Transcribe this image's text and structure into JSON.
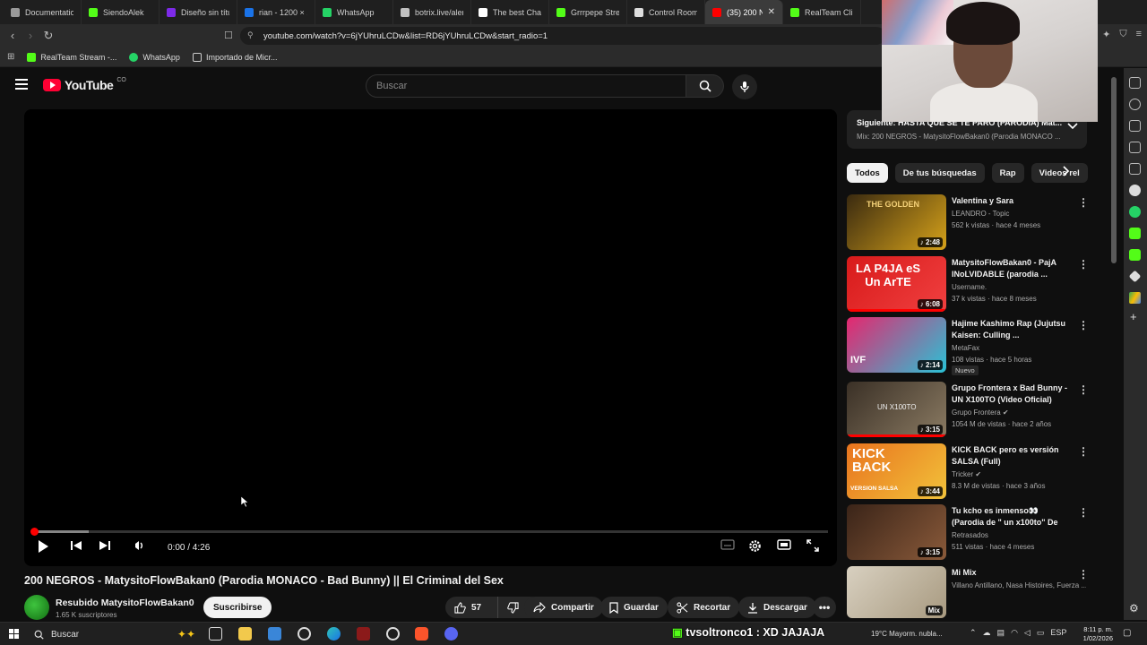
{
  "browser": {
    "tabs": [
      {
        "label": "Documentation",
        "color": "#9a9a9a"
      },
      {
        "label": "SiendoAlek",
        "color": "#53fc18"
      },
      {
        "label": "Diseño sin título",
        "color": "#7d2ae8"
      },
      {
        "label": "rian - 1200 × 12",
        "color": "#1a73e8"
      },
      {
        "label": "WhatsApp",
        "color": "#25d366"
      },
      {
        "label": "botrix.live/alert",
        "color": "#c0c0c0"
      },
      {
        "label": "The best ChatB",
        "color": "#ffffff"
      },
      {
        "label": "Grrrpepe Stream",
        "color": "#53fc18"
      },
      {
        "label": "Control Room",
        "color": "#dddddd"
      },
      {
        "label": "(35) 200 N",
        "color": "#ff0000"
      },
      {
        "label": "RealTeam Clips",
        "color": "#53fc18"
      }
    ],
    "url": "youtube.com/watch?v=6jYUhruLCDw&list=RD6jYUhruLCDw&start_radio=1",
    "bookmarks": [
      {
        "label": "RealTeam Stream -...",
        "color": "#53fc18"
      },
      {
        "label": "WhatsApp",
        "color": "#25d366"
      },
      {
        "label": "Importado de Micr...",
        "color": "#cccccc"
      }
    ]
  },
  "youtube": {
    "logo_text": "YouTube",
    "country_code": "CO",
    "search_placeholder": "Buscar",
    "player": {
      "time": "0:00 / 4:26",
      "progress_fraction": 0.0,
      "buffer_fraction": 0.07
    },
    "video": {
      "title": "200 NEGROS - MatysitoFlowBakan0 (Parodia MONACO - Bad Bunny) || El Criminal del Sex",
      "channel": "Resubido MatysitoFlowBakan0",
      "subscribers": "1.65 K suscriptores",
      "subscribe_label": "Suscribirse",
      "likes": "57",
      "share_label": "Compartir",
      "save_label": "Guardar",
      "clip_label": "Recortar",
      "download_label": "Descargar"
    },
    "next": {
      "title": "Siguiente: HASTA QUE SE TE PARO (PARODIA) Mat...",
      "subtitle": "Mix: 200 NEGROS - MatysitoFlowBakan0 (Parodia MONACO ..."
    },
    "chips": [
      "Todos",
      "De tus búsquedas",
      "Rap",
      "Videos rel"
    ],
    "recommendations": [
      {
        "title": "Valentina y Sara",
        "channel": "LEANDRO - Topic",
        "meta": "562 k vistas · hace 4 meses",
        "duration": "2:48",
        "thumb_colors": [
          "#3a2a10",
          "#d6a21a"
        ],
        "badge": "",
        "verified": false
      },
      {
        "title": "MatysitoFlowBakan0 - PajA INoLVIDABLE (parodia ...",
        "channel": "Username.",
        "meta": "37 k vistas · hace 8 meses",
        "duration": "6:08",
        "thumb_colors": [
          "#d81a1a",
          "#f04040"
        ],
        "badge": "",
        "verified": false
      },
      {
        "title": "Hajime Kashimo Rap (Jujutsu Kaisen: Culling ...",
        "channel": "MetaFax",
        "meta": "108 vistas · hace 5 horas",
        "duration": "2:14",
        "thumb_colors": [
          "#e6266e",
          "#29c2d6"
        ],
        "badge": "Nuevo",
        "verified": false
      },
      {
        "title": "Grupo Frontera x Bad Bunny - UN X100TO (Video Oficial)",
        "channel": "Grupo Frontera",
        "meta": "1054 M de vistas · hace 2 años",
        "duration": "3:15",
        "thumb_colors": [
          "#3a3026",
          "#8a7a62"
        ],
        "badge": "",
        "verified": true
      },
      {
        "title": "KICK BACK pero es versión SALSA (Full)",
        "channel": "Tricker",
        "meta": "8.3 M de vistas · hace 3 años",
        "duration": "3:44",
        "thumb_colors": [
          "#e8731e",
          "#f2c23a"
        ],
        "badge": "",
        "verified": true
      },
      {
        "title": "Tu kcho es inmenso👀 (Parodia de \" un x100to\" De Grupo ...",
        "channel": "Retrasados",
        "meta": "511 vistas · hace 4 meses",
        "duration": "3:15",
        "thumb_colors": [
          "#3a2418",
          "#8a5a3a"
        ],
        "badge": "",
        "verified": false
      },
      {
        "title": "Mi Mix",
        "channel": "Villano Antillano, Nasa Histoires, Fuerza ...",
        "meta": "",
        "duration": "Mix",
        "thumb_colors": [
          "#d8d0c0",
          "#a89a80"
        ],
        "badge": "",
        "verified": false
      }
    ],
    "thumb_texts": {
      "t1": "THE GOLDEN",
      "t2": "LA P4JA eS Un ArTE",
      "t3": "IVF",
      "t4": "UN X100TO",
      "t5": "KICK BACK",
      "t5b": "VERSION SALSA"
    }
  },
  "taskbar": {
    "search_label": "Buscar",
    "chat_overlay": "tvsoltronco1 : XD JAJAJA",
    "weather": "19°C  Mayorm. nubla...",
    "language": "ESP",
    "time": "8:11 p. m.",
    "date": "1/02/2026"
  }
}
